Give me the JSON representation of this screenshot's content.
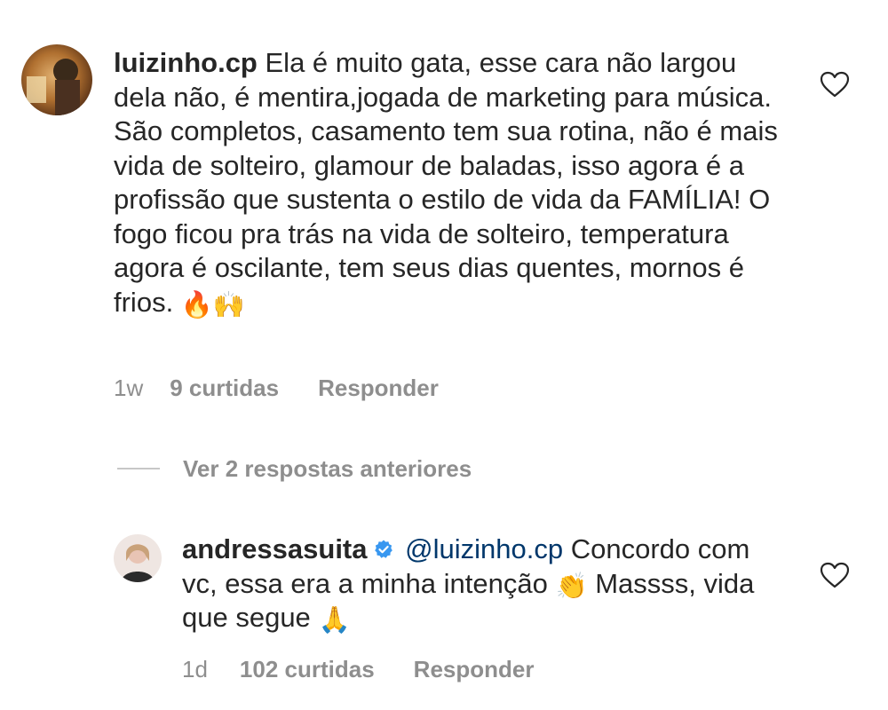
{
  "comment1": {
    "username": "luizinho.cp",
    "text": "Ela é muito gata, esse cara não largou dela não, é mentira,jogada de marketing para música. São completos, casamento tem sua rotina, não é mais vida de solteiro, glamour de baladas, isso agora é a profissão que sustenta o estilo de vida da FAMÍLIA! O fogo ficou pra trás na vida de solteiro,  temperatura agora é oscilante, tem seus dias quentes, mornos é frios.",
    "emojis": [
      "🔥",
      "🙌"
    ],
    "time": "1w",
    "likes": "9 curtidas",
    "reply_label": "Responder"
  },
  "replies_toggle": {
    "label": "Ver 2 respostas anteriores"
  },
  "comment2": {
    "username": "andressasuita",
    "verified": true,
    "mention": "@luizinho.cp",
    "text_part1": "Concordo com vc, essa era a minha intenção",
    "emoji1": "👏",
    "text_part2": "Massss, vida que segue",
    "emoji2": "🙏",
    "time": "1d",
    "likes": "102 curtidas",
    "reply_label": "Responder"
  },
  "icons": {
    "like": "heart-outline-icon",
    "verified": "verified-badge-icon"
  },
  "colors": {
    "text": "#262626",
    "muted": "#8e8e8e",
    "mention": "#00376b",
    "verified": "#3897f0"
  }
}
